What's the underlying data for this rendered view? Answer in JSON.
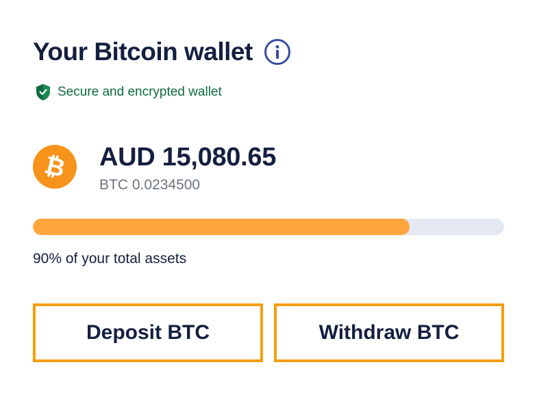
{
  "wallet": {
    "title": "Your Bitcoin wallet",
    "secure_text": "Secure and encrypted wallet",
    "fiat_balance": "AUD 15,080.65",
    "crypto_balance": "BTC 0.0234500",
    "assets_progress": 0.8,
    "assets_text": "90% of your total assets"
  },
  "actions": {
    "deposit_label": "Deposit BTC",
    "withdraw_label": "Withdraw BTC"
  },
  "colors": {
    "title": "#141f40",
    "secure_green": "#0e6b3e",
    "bitcoin_orange": "#f7931a",
    "progress_fill": "#ffa63f",
    "progress_track": "#e4e8f2",
    "button_border": "#f59e0b",
    "info_icon": "#3a4a9e"
  },
  "icons": {
    "info": "info-circle-icon",
    "secure": "shield-check-icon",
    "currency": "bitcoin-icon"
  }
}
